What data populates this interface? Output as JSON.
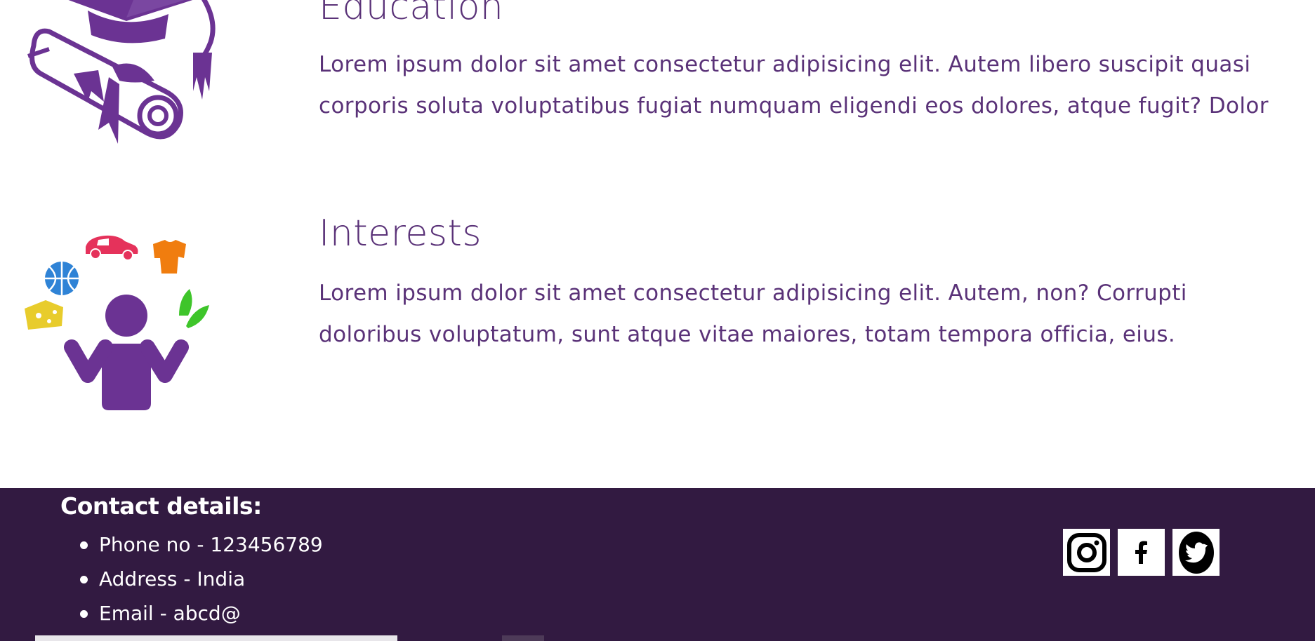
{
  "education": {
    "title": "Education",
    "icon": "graduation-cap-diploma-icon",
    "lines": [
      "Lorem ipsum dolor sit amet consectetur adipisicing elit. Autem libero suscipit quasi",
      "corporis soluta voluptatibus fugiat numquam eligendi eos dolores, atque fugit? Dolor"
    ]
  },
  "interests": {
    "title": "Interests",
    "icon": "juggling-person-icon",
    "lines": [
      "Lorem ipsum dolor sit amet consectetur adipisicing elit. Autem, non? Corrupti",
      "doloribus voluptatum, sunt atque vitae maiores, totam tempora officia, eius."
    ]
  },
  "footer": {
    "title": "Contact details:",
    "contacts": [
      "Phone no - 123456789",
      "Address - India",
      "Email - abcd@"
    ],
    "socials": [
      {
        "name": "instagram",
        "icon": "instagram-icon"
      },
      {
        "name": "facebook",
        "icon": "facebook-icon"
      },
      {
        "name": "twitter",
        "icon": "twitter-icon"
      }
    ]
  },
  "colors": {
    "accent_purple": "#6b3393",
    "text_purple": "#5a3278",
    "footer_bg": "#321a41"
  }
}
